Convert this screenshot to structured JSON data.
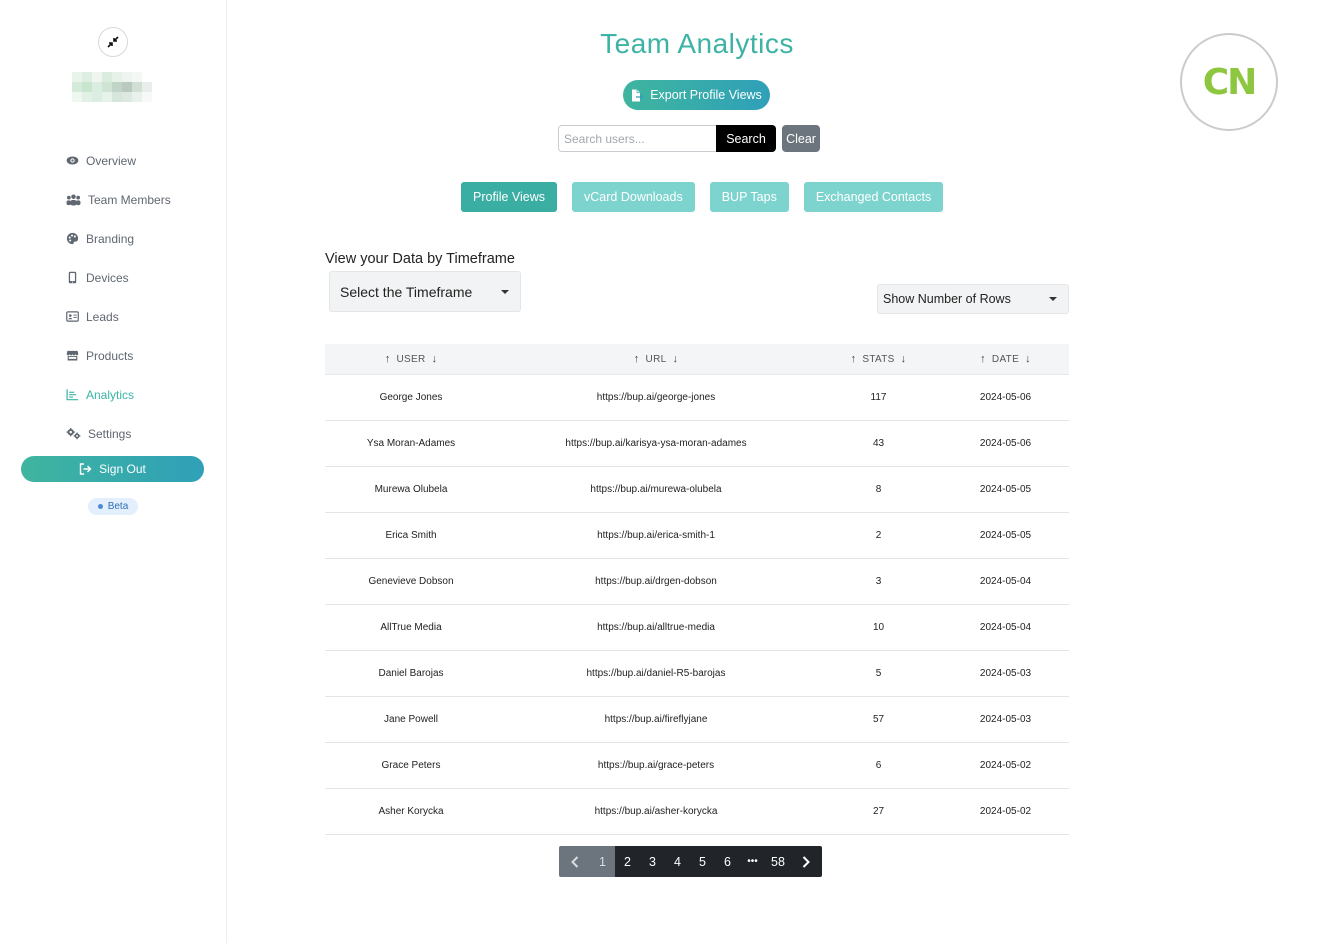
{
  "sidebar": {
    "items": [
      {
        "label": "Overview",
        "icon": "eye-icon"
      },
      {
        "label": "Team Members",
        "icon": "users-icon"
      },
      {
        "label": "Branding",
        "icon": "palette-icon"
      },
      {
        "label": "Devices",
        "icon": "mobile-icon"
      },
      {
        "label": "Leads",
        "icon": "id-card-icon"
      },
      {
        "label": "Products",
        "icon": "store-icon"
      },
      {
        "label": "Analytics",
        "icon": "chart-icon",
        "active": true
      },
      {
        "label": "Settings",
        "icon": "gears-icon"
      }
    ],
    "signout_label": "Sign Out",
    "beta_label": "Beta"
  },
  "header": {
    "title": "Team Analytics",
    "export_label": "Export Profile Views",
    "search_placeholder": "Search users...",
    "search_label": "Search",
    "clear_label": "Clear",
    "logo_text": "CN"
  },
  "tabs": [
    {
      "label": "Profile Views",
      "active": true
    },
    {
      "label": "vCard Downloads",
      "active": false
    },
    {
      "label": "BUP Taps",
      "active": false
    },
    {
      "label": "Exchanged Contacts",
      "active": false
    }
  ],
  "filters": {
    "timeframe_heading": "View your Data by Timeframe",
    "timeframe_select": "Select the Timeframe",
    "rows_select": "Show Number of Rows"
  },
  "table": {
    "columns": [
      "USER",
      "URL",
      "STATS",
      "DATE"
    ],
    "rows": [
      {
        "user": "George Jones",
        "url": "https://bup.ai/george-jones",
        "stats": "117",
        "date": "2024-05-06"
      },
      {
        "user": "Ysa Moran-Adames",
        "url": "https://bup.ai/karisya-ysa-moran-adames",
        "stats": "43",
        "date": "2024-05-06"
      },
      {
        "user": "Murewa Olubela",
        "url": "https://bup.ai/murewa-olubela",
        "stats": "8",
        "date": "2024-05-05"
      },
      {
        "user": "Erica Smith",
        "url": "https://bup.ai/erica-smith-1",
        "stats": "2",
        "date": "2024-05-05"
      },
      {
        "user": "Genevieve Dobson",
        "url": "https://bup.ai/drgen-dobson",
        "stats": "3",
        "date": "2024-05-04"
      },
      {
        "user": "AllTrue Media",
        "url": "https://bup.ai/alltrue-media",
        "stats": "10",
        "date": "2024-05-04"
      },
      {
        "user": "Daniel Barojas",
        "url": "https://bup.ai/daniel-R5-barojas",
        "stats": "5",
        "date": "2024-05-03"
      },
      {
        "user": "Jane Powell",
        "url": "https://bup.ai/fireflyjane",
        "stats": "57",
        "date": "2024-05-03"
      },
      {
        "user": "Grace Peters",
        "url": "https://bup.ai/grace-peters",
        "stats": "6",
        "date": "2024-05-02"
      },
      {
        "user": "Asher Korycka",
        "url": "https://bup.ai/asher-korycka",
        "stats": "27",
        "date": "2024-05-02"
      }
    ]
  },
  "pagination": {
    "pages": [
      "1",
      "2",
      "3",
      "4",
      "5",
      "6",
      "•••",
      "58"
    ],
    "current": "1"
  },
  "colors": {
    "accent": "#3db3a5",
    "tab_active": "#3aaea3",
    "tab_inactive": "#7dd4cf",
    "logo_green": "#8dc63f"
  }
}
